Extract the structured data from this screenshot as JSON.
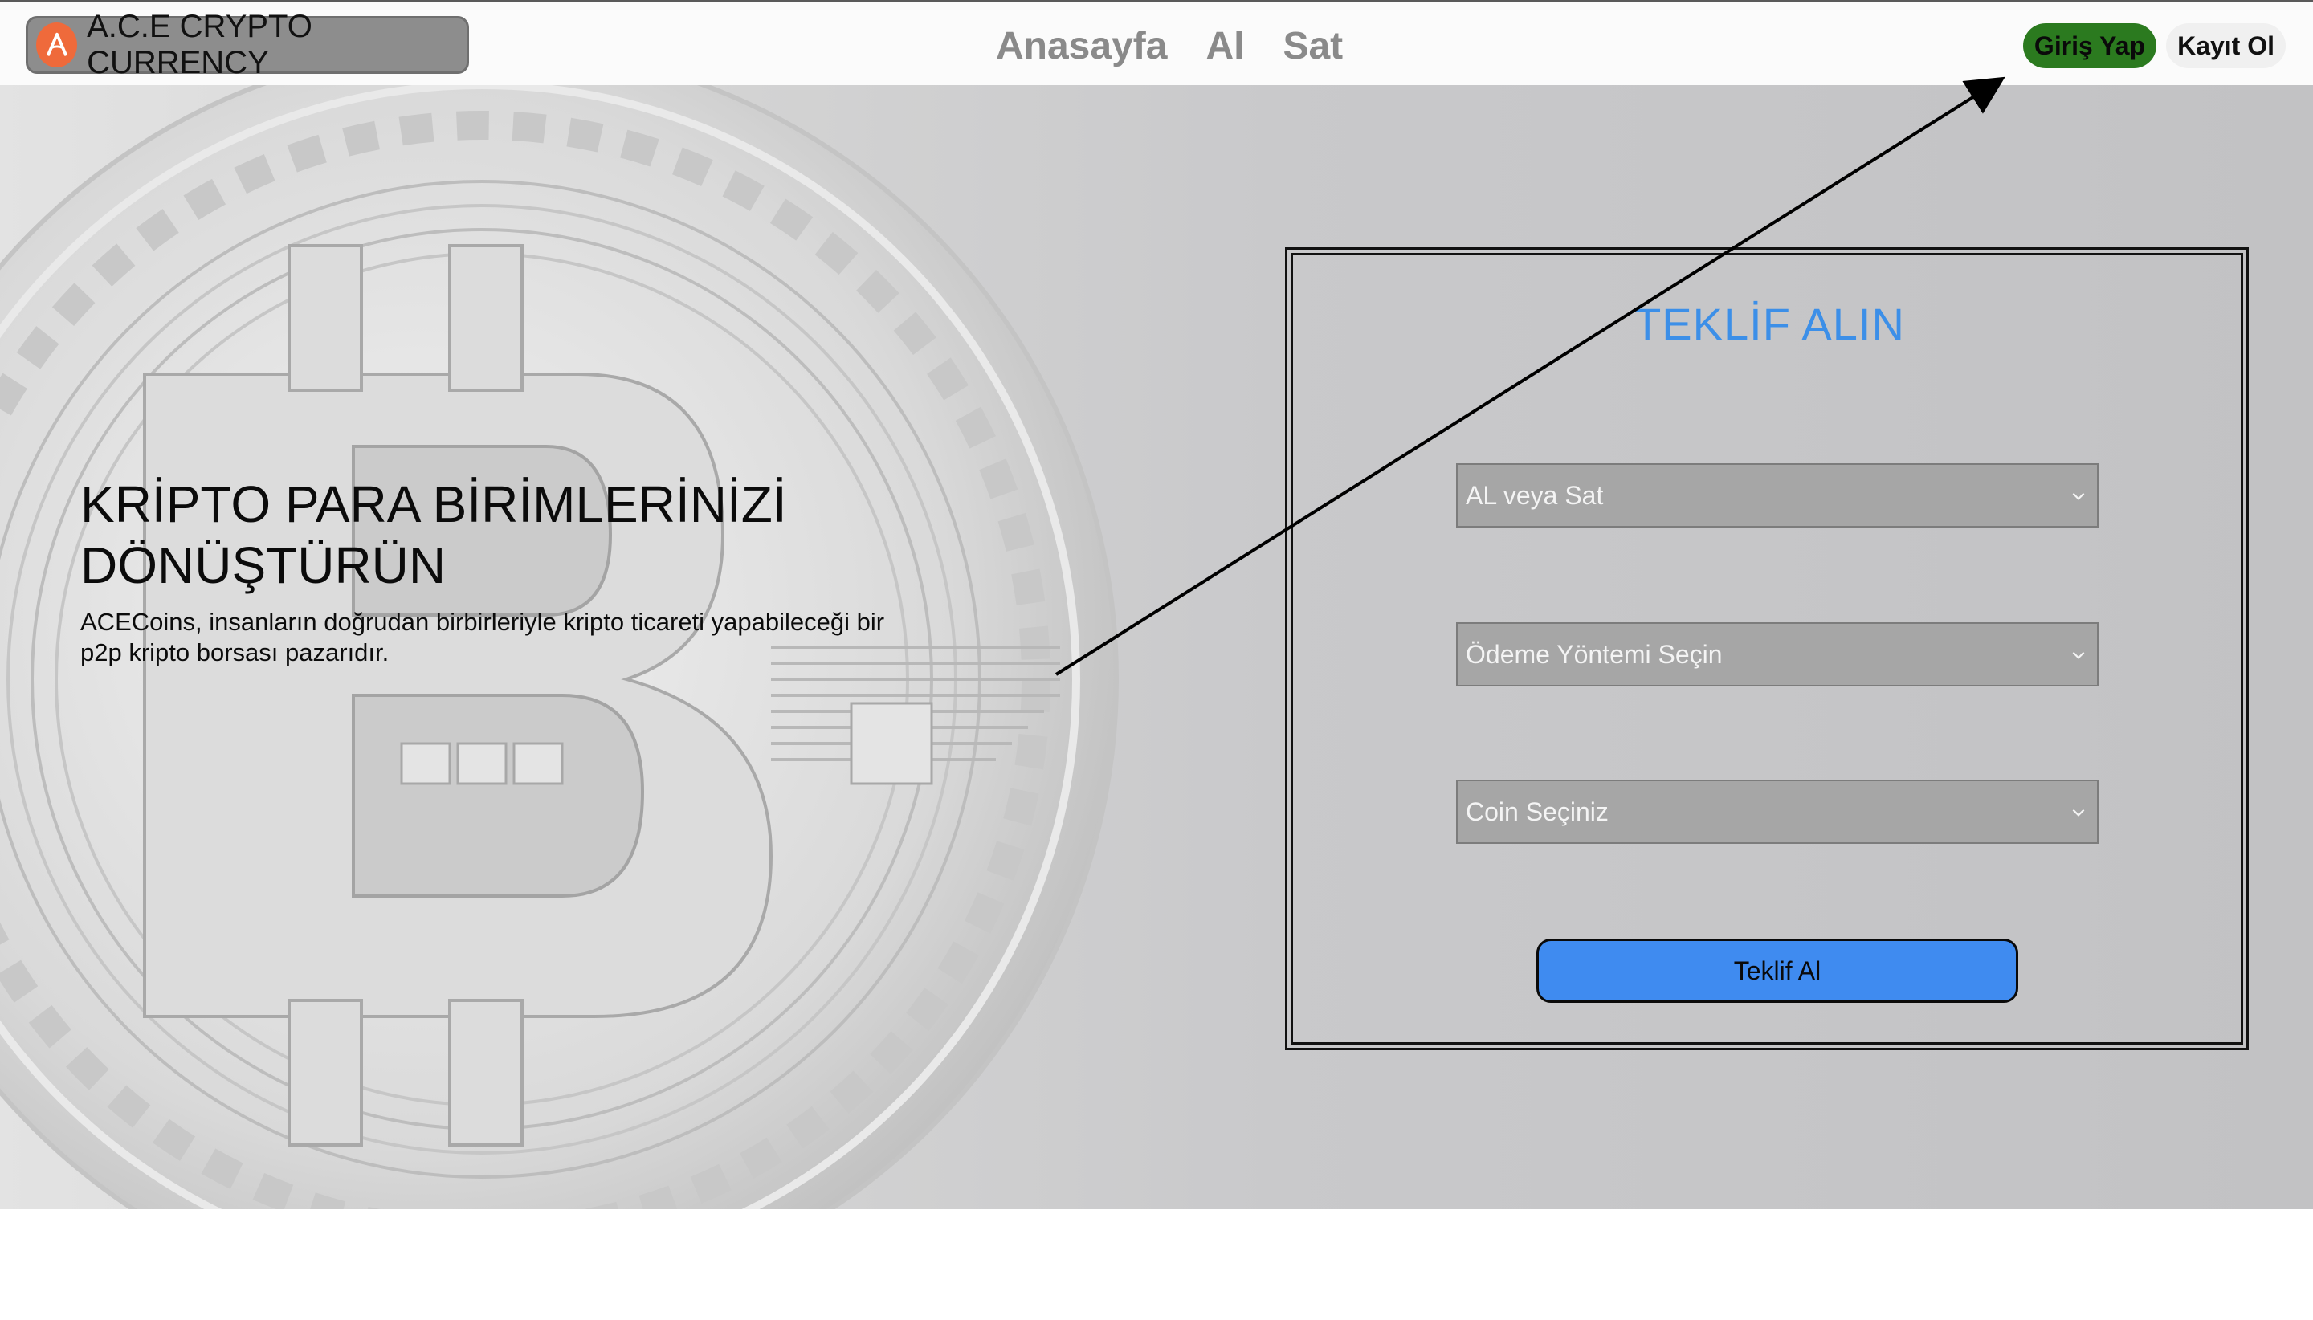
{
  "navbar": {
    "brand": "A.C.E CRYPTO CURRENCY",
    "links": [
      "Anasayfa",
      "Al",
      "Sat"
    ],
    "login": "Giriş Yap",
    "register": "Kayıt Ol"
  },
  "hero": {
    "title": "KRİPTO PARA BİRİMLERİNİZİ DÖNÜŞTÜRÜN",
    "description": "ACECoins, insanların doğrudan birbirleriyle kripto ticareti yapabileceği bir p2p kripto borsası pazarıdır."
  },
  "form": {
    "title": "TEKLİF ALIN",
    "select_action": "AL veya Sat",
    "select_payment": "Ödeme Yöntemi Seçin",
    "select_coin": "Coin Seçiniz",
    "submit": "Teklif Al"
  },
  "colors": {
    "brand_logo": "#ef6a3b",
    "login_button": "#2b7a1f",
    "form_title": "#3c8fe8",
    "submit_button": "#3f8bf0"
  },
  "icons": {
    "brand": "ace-logo-icon",
    "select": "chevron-down-icon"
  }
}
